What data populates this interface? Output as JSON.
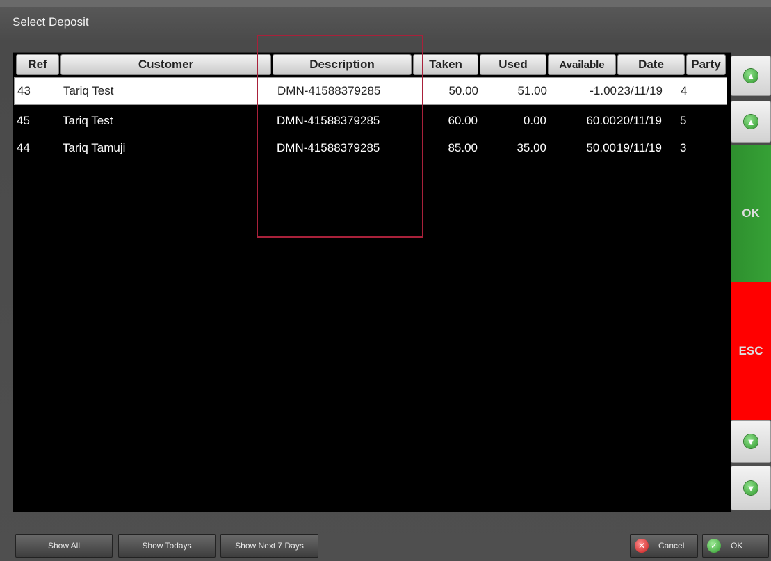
{
  "window": {
    "title": "Select Deposit"
  },
  "table": {
    "columns": [
      "Ref",
      "Customer",
      "Description",
      "Taken",
      "Used",
      "Available",
      "Date",
      "Party"
    ],
    "rows": [
      {
        "ref": "43",
        "customer": "Tariq Test",
        "description": "DMN-41588379285",
        "taken": "50.00",
        "used": "51.00",
        "available": "-1.00",
        "date": "23/11/19",
        "party": "4",
        "selected": true
      },
      {
        "ref": "45",
        "customer": "Tariq Test",
        "description": "DMN-41588379285",
        "taken": "60.00",
        "used": "0.00",
        "available": "60.00",
        "date": "20/11/19",
        "party": "5",
        "selected": false
      },
      {
        "ref": "44",
        "customer": "Tariq Tamuji",
        "description": "DMN-41588379285",
        "taken": "85.00",
        "used": "35.00",
        "available": "50.00",
        "date": "19/11/19",
        "party": "3",
        "selected": false
      }
    ]
  },
  "side": {
    "up_icon": "arrow-up-icon",
    "down_icon": "arrow-down-icon",
    "ok_label": "OK",
    "esc_label": "ESC"
  },
  "bottom": {
    "show_all": "Show All",
    "show_todays": "Show Todays",
    "show_next_7_days": "Show Next 7 Days",
    "cancel_label": "Cancel",
    "ok_label": "OK"
  },
  "colors": {
    "ok_green": "#36a136",
    "esc_red": "#ff0000",
    "highlight_box": "#a8213a"
  }
}
